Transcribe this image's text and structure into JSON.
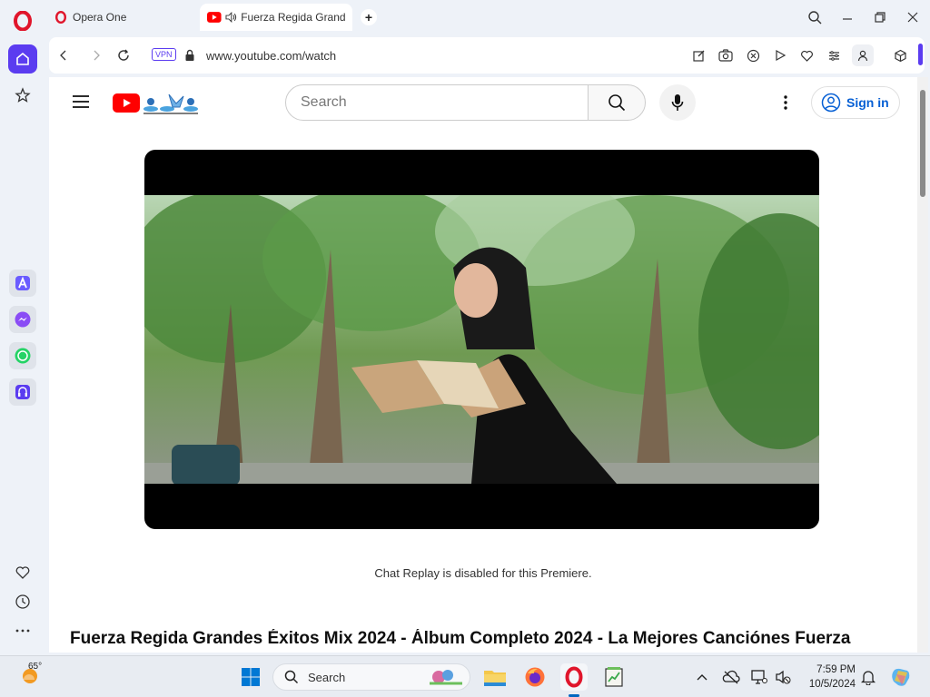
{
  "browser": {
    "tabs": [
      {
        "label": "Opera One"
      },
      {
        "label": "Fuerza Regida Grande"
      }
    ],
    "vpn_label": "VPN",
    "url": "www.youtube.com/watch"
  },
  "youtube": {
    "search_placeholder": "Search",
    "sign_in_label": "Sign in",
    "chat_note": "Chat Replay is disabled for this Premiere.",
    "video_title": "Fuerza Regida Grandes Éxitos Mix 2024 - Álbum Completo 2024 - La Mejores Canciónes Fuerza"
  },
  "taskbar": {
    "weather_temp": "65°",
    "search_label": "Search",
    "time": "7:59 PM",
    "date": "10/5/2024"
  },
  "colors": {
    "opera_accent": "#5b3cf0",
    "youtube_red": "#ff0000",
    "signin_blue": "#065fd4"
  }
}
